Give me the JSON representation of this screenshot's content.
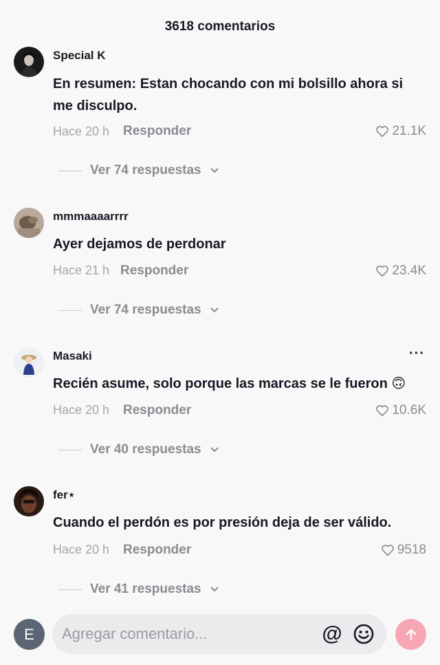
{
  "header": {
    "title": "3618 comentarios"
  },
  "comments": [
    {
      "username": "Special K",
      "text": "En resumen: Estan chocando con mi bolsillo ahora si me disculpo.",
      "time": "Hace 20 h",
      "reply_label": "Responder",
      "likes": "21.1K",
      "view_replies": "Ver 74 respuestas"
    },
    {
      "username": "mmmaaaarrrr",
      "text": "Ayer dejamos de perdonar",
      "time": "Hace 21 h",
      "reply_label": "Responder",
      "likes": "23.4K",
      "view_replies": "Ver 74 respuestas"
    },
    {
      "username": "Masaki",
      "text": "Recién asume, solo porque las marcas se le fueron 🙃",
      "time": "Hace 20 h",
      "reply_label": "Responder",
      "likes": "10.6K",
      "view_replies": "Ver 40 respuestas",
      "more_menu": "···"
    },
    {
      "username": "fer⋆",
      "text": "Cuando el perdón es por presión deja de ser válido.",
      "time": "Hace 20 h",
      "reply_label": "Responder",
      "likes": "9518",
      "view_replies": "Ver 41 respuestas"
    }
  ],
  "composer": {
    "user_initial": "E",
    "placeholder": "Agregar comentario...",
    "mention_symbol": "@",
    "icons": [
      "mention-icon",
      "emoji-icon",
      "send-arrow-icon"
    ]
  },
  "colors": {
    "background": "#f8f8f8",
    "text": "#161823",
    "muted": "#8a8b91",
    "send_button": "#f7a7b3"
  }
}
